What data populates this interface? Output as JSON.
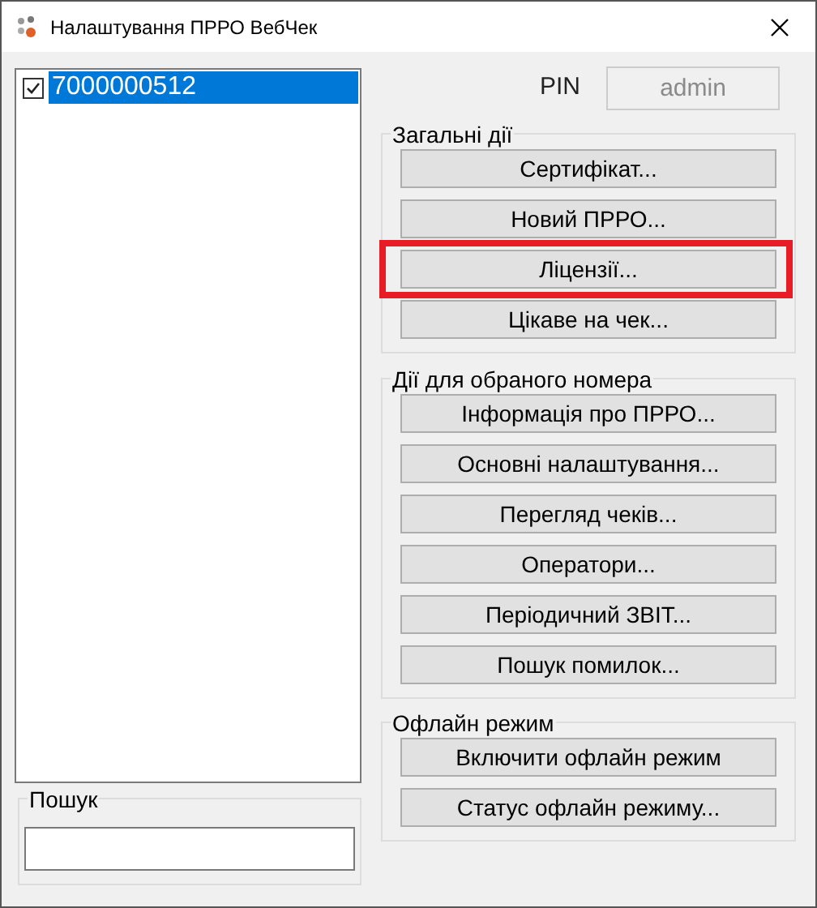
{
  "window": {
    "title": "Налаштування ПРРО ВебЧек"
  },
  "list": {
    "items": [
      {
        "label": "7000000512",
        "checked": true,
        "selected": true
      }
    ]
  },
  "search": {
    "label": "Пошук"
  },
  "pin": {
    "label": "PIN",
    "value": "admin",
    "disabled": true
  },
  "groups": [
    {
      "title": "Загальні дії",
      "buttons": [
        {
          "label": "Сертифікат...",
          "highlighted": false
        },
        {
          "label": "Новий ПРРО...",
          "highlighted": false
        },
        {
          "label": "Ліцензії...",
          "highlighted": true
        },
        {
          "label": "Цікаве на чек...",
          "highlighted": false
        }
      ]
    },
    {
      "title": "Дії для обраного номера",
      "buttons": [
        {
          "label": "Інформація про ПРРО...",
          "highlighted": false
        },
        {
          "label": "Основні налаштування...",
          "highlighted": false
        },
        {
          "label": "Перегляд чеків...",
          "highlighted": false
        },
        {
          "label": "Оператори...",
          "highlighted": false
        },
        {
          "label": "Періодичний ЗВІТ...",
          "highlighted": false
        },
        {
          "label": "Пошук помилок...",
          "highlighted": false
        }
      ]
    },
    {
      "title": "Офлайн режим",
      "buttons": [
        {
          "label": "Включити офлайн режим",
          "highlighted": false
        },
        {
          "label": "Статус офлайн режиму...",
          "highlighted": false
        }
      ]
    }
  ]
}
